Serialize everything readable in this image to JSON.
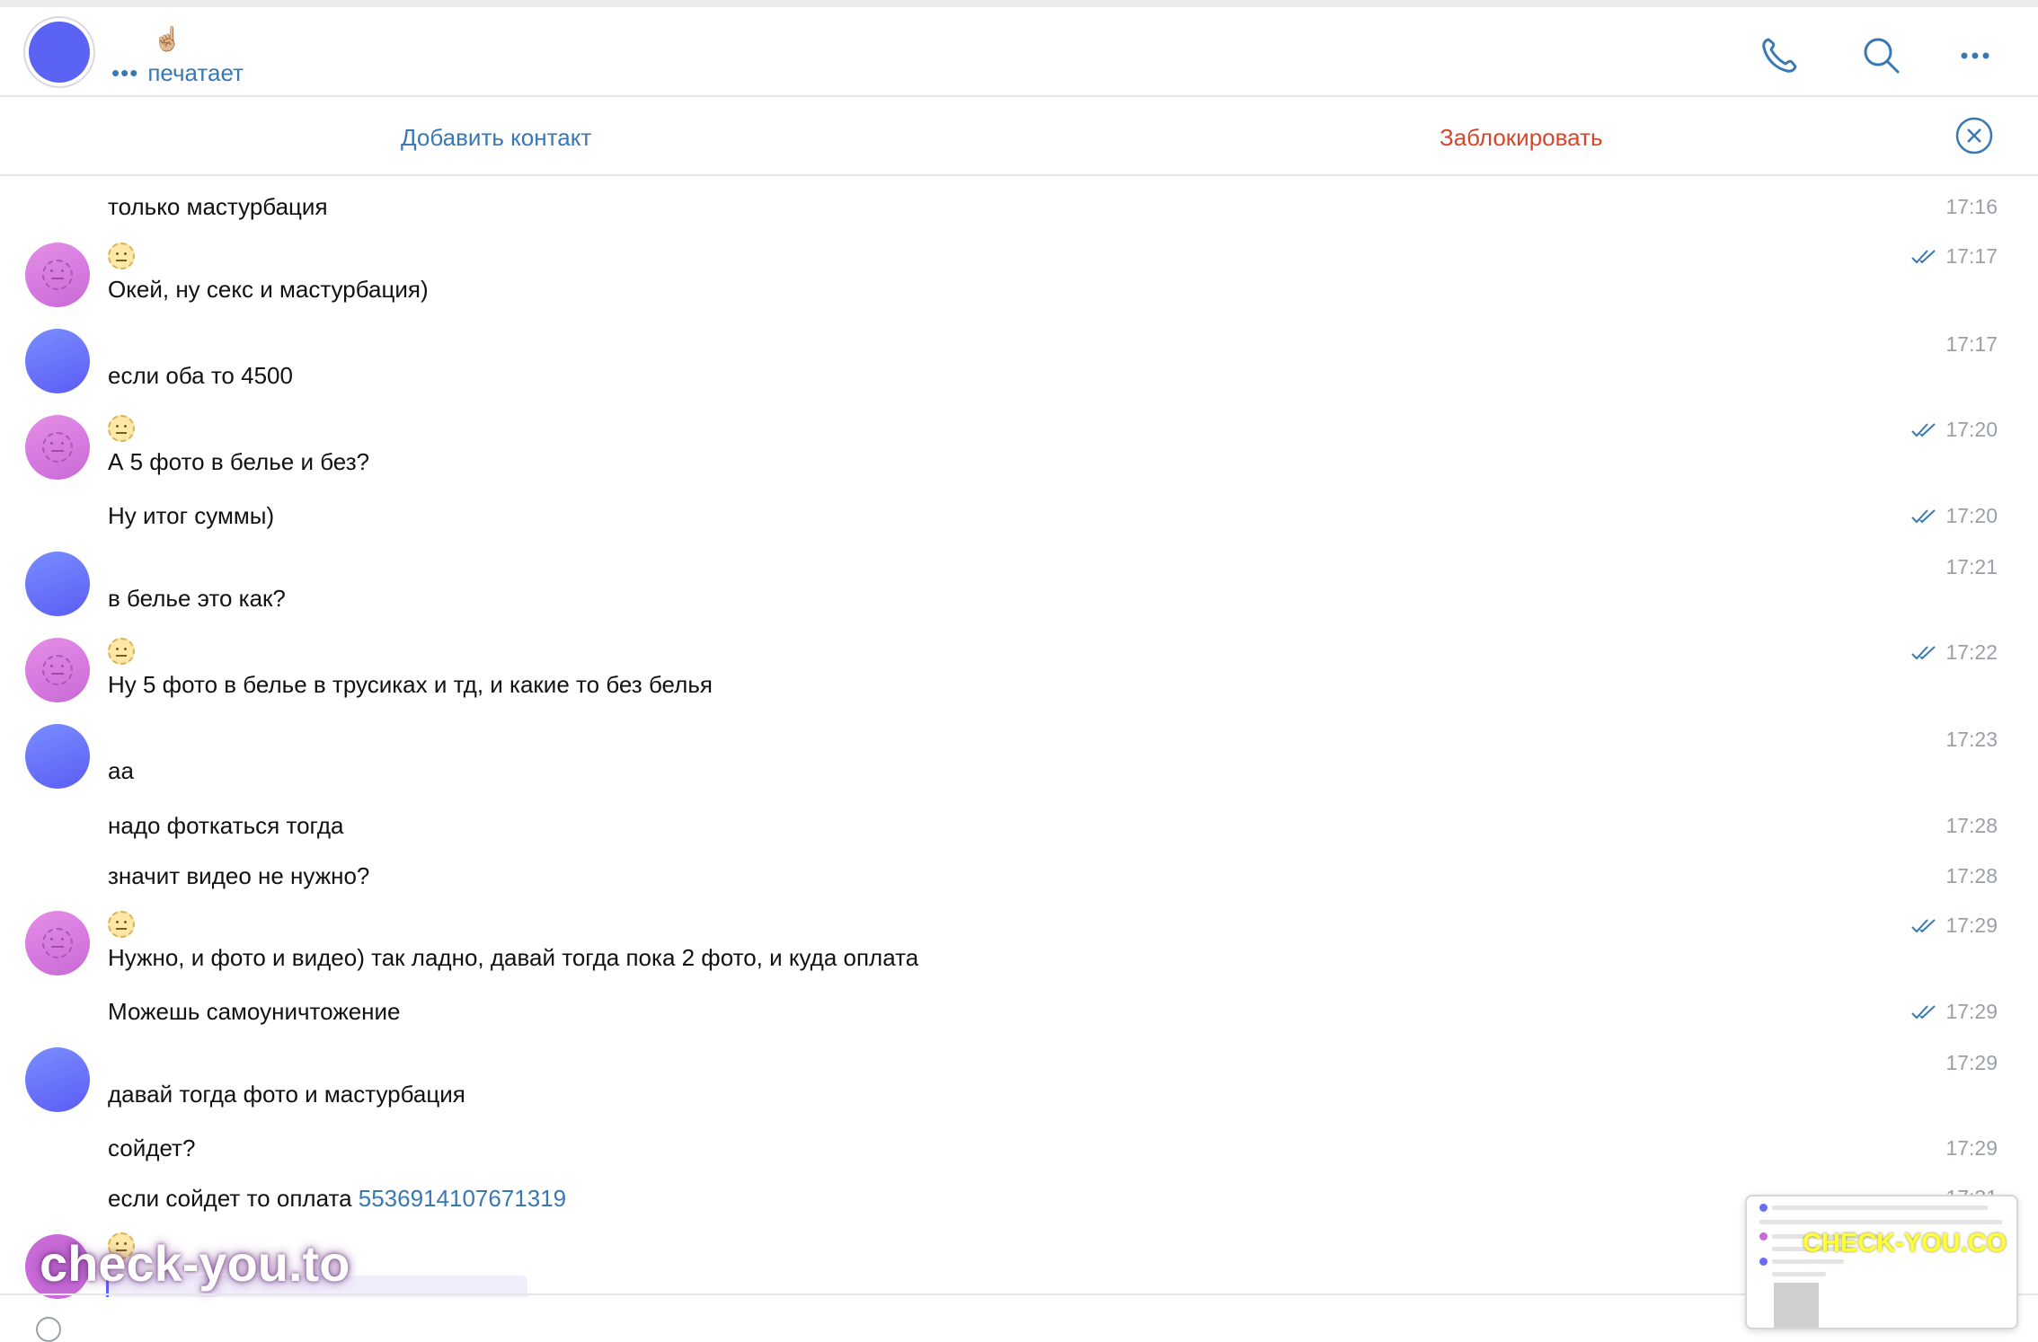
{
  "header": {
    "typing_emoji": "☝🏼",
    "typing_dots": "•••",
    "typing_text": "печатает",
    "icons": [
      "phone-icon",
      "search-icon",
      "more-icon"
    ]
  },
  "action_bar": {
    "add_contact": "Добавить контакт",
    "block": "Заблокировать"
  },
  "messages": [
    {
      "text": "только мастурбация",
      "time": "17:16"
    },
    {
      "text": "Окей, ну секс и мастурбация)",
      "time": "17:17"
    },
    {
      "text": "если оба то 4500",
      "time": "17:17"
    },
    {
      "text": "А 5 фото в белье и без?",
      "time": "17:20"
    },
    {
      "text": "Ну итог суммы)",
      "time": "17:20"
    },
    {
      "text": "в белье это как?",
      "time": "17:21"
    },
    {
      "text": "Ну 5 фото в белье в трусиках и тд, и какие то без белья",
      "time": "17:22"
    },
    {
      "text": "аа",
      "time": "17:23"
    },
    {
      "text": "надо фоткаться тогда",
      "time": "17:28"
    },
    {
      "text": "значит видео не нужно?",
      "time": "17:28"
    },
    {
      "text": "Нужно, и фото и видео) так ладно, давай тогда пока 2 фото, и куда оплата",
      "time": "17:29"
    },
    {
      "text": "Можешь самоуничтожение",
      "time": "17:29"
    },
    {
      "text": "давай тогда фото и мастурбация",
      "time": "17:29"
    },
    {
      "text": "сойдет?",
      "time": "17:29"
    },
    {
      "text": "если сойдет то оплата ",
      "link": "5536914107671319",
      "time": "17:31"
    }
  ],
  "watermark": "check-you.to",
  "thumbnail": {
    "watermark": "CHECK-YOU.CO"
  }
}
